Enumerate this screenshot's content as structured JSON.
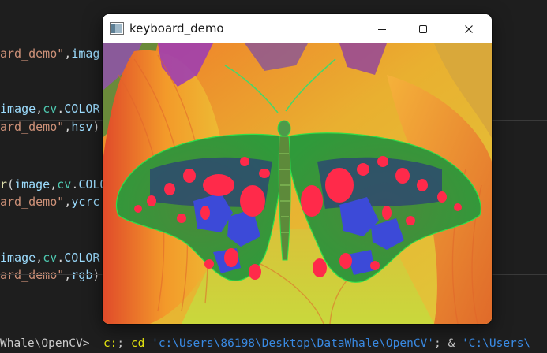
{
  "editor": {
    "lines": [
      {
        "tokens": [
          {
            "t": "ard_demo\"",
            "c": "str"
          },
          {
            "t": ",",
            "c": "pun"
          },
          {
            "t": "imag",
            "c": "var"
          }
        ]
      },
      {
        "tokens": [
          {
            "t": "image",
            "c": "var"
          },
          {
            "t": ",",
            "c": "pun"
          },
          {
            "t": "cv",
            "c": "mod"
          },
          {
            "t": ".",
            "c": "pun"
          },
          {
            "t": "COLOR",
            "c": "var"
          }
        ]
      },
      {
        "tokens": [
          {
            "t": "ard_demo\"",
            "c": "str"
          },
          {
            "t": ",",
            "c": "pun"
          },
          {
            "t": "hsv",
            "c": "var"
          },
          {
            "t": ")",
            "c": "pun"
          }
        ]
      },
      {
        "tokens": [
          {
            "t": "r",
            "c": "fn"
          },
          {
            "t": "(",
            "c": "pun"
          },
          {
            "t": "image",
            "c": "var"
          },
          {
            "t": ",",
            "c": "pun"
          },
          {
            "t": "cv",
            "c": "mod"
          },
          {
            "t": ".",
            "c": "pun"
          },
          {
            "t": "COLO",
            "c": "var"
          }
        ]
      },
      {
        "tokens": [
          {
            "t": "ard_demo\"",
            "c": "str"
          },
          {
            "t": ",",
            "c": "pun"
          },
          {
            "t": "ycrc",
            "c": "var"
          }
        ]
      },
      {
        "tokens": [
          {
            "t": "image",
            "c": "var"
          },
          {
            "t": ",",
            "c": "pun"
          },
          {
            "t": "cv",
            "c": "mod"
          },
          {
            "t": ".",
            "c": "pun"
          },
          {
            "t": "COLOR",
            "c": "var"
          }
        ]
      },
      {
        "tokens": [
          {
            "t": "ard_demo\"",
            "c": "str"
          },
          {
            "t": ",",
            "c": "pun"
          },
          {
            "t": "rgb",
            "c": "var"
          },
          {
            "t": ")",
            "c": "pun"
          }
        ]
      }
    ]
  },
  "terminal": {
    "tokens": [
      {
        "t": "Whale\\OpenCV>  ",
        "c": "op"
      },
      {
        "t": "c:",
        "c": "cmd"
      },
      {
        "t": "; ",
        "c": "op"
      },
      {
        "t": "cd",
        "c": "cmd"
      },
      {
        "t": " ",
        "c": "op"
      },
      {
        "t": "'c:\\Users\\86198\\Desktop\\DataWhale\\OpenCV'",
        "c": "str"
      },
      {
        "t": "; & ",
        "c": "op"
      },
      {
        "t": "'C:\\Users\\",
        "c": "str"
      }
    ]
  },
  "window": {
    "title": "keyboard_demo",
    "icon": "app-window-icon",
    "controls": [
      "minimize-icon",
      "maximize-icon",
      "close-icon"
    ]
  },
  "image": {
    "subject": "butterfly",
    "colors": {
      "leaf_orange": "#f08a2a",
      "leaf_yellow": "#e8d23a",
      "wing_green": "#3cc33a",
      "spot_red": "#ff2a4a",
      "patch_blue": "#3c4ad8",
      "bg_purple": "#9a3ab8"
    }
  },
  "theme": {
    "editor_bg": "#1e1e1e",
    "string": "#ce9178",
    "variable": "#9cdcfe",
    "module": "#4ec9b0"
  }
}
